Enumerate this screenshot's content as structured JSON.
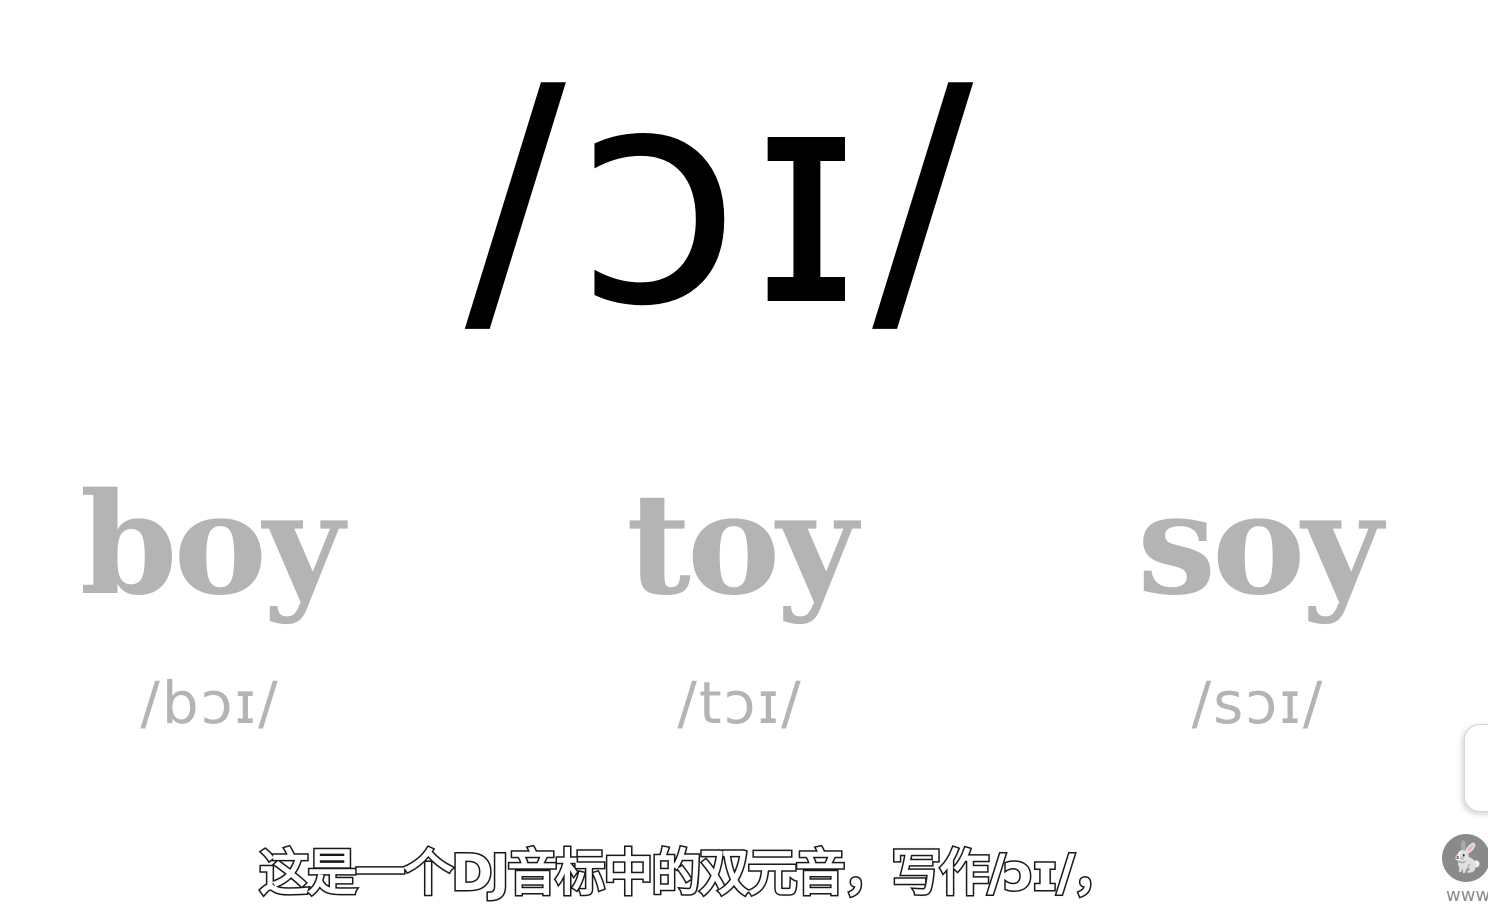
{
  "main": {
    "phoneme": "/ɔɪ/"
  },
  "examples": [
    {
      "word": "boy",
      "ipa": "/bɔɪ/"
    },
    {
      "word": "toy",
      "ipa": "/tɔɪ/"
    },
    {
      "word": "soy",
      "ipa": "/sɔɪ/"
    }
  ],
  "subtitle": {
    "text": "这是一个DJ音标中的双元音，写作/ɔɪ/，"
  },
  "watermark": {
    "icon": "rabbit-logo-icon",
    "glyph": "🐇",
    "text": "www"
  }
}
